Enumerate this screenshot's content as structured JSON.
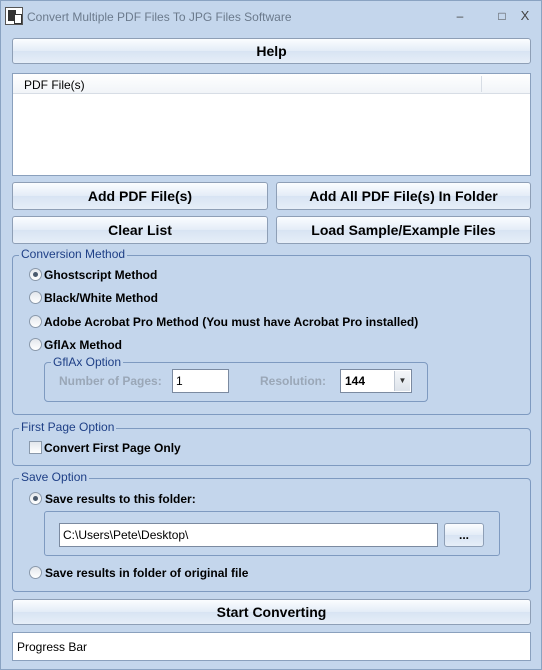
{
  "window": {
    "title": "Convert Multiple PDF Files To JPG Files Software",
    "minimize_glyph": "–",
    "maximize_glyph": "□",
    "close_glyph": "X"
  },
  "buttons": {
    "help": "Help",
    "add_pdf": "Add PDF File(s)",
    "add_all_pdf": "Add All PDF File(s) In Folder",
    "clear_list": "Clear List",
    "load_sample": "Load Sample/Example Files",
    "start_converting": "Start Converting",
    "browse": "..."
  },
  "file_list": {
    "columns": [
      "PDF File(s)"
    ],
    "rows": []
  },
  "conversion_method": {
    "label": "Conversion Method",
    "options": [
      {
        "label": "Ghostscript Method",
        "selected": true
      },
      {
        "label": "Black/White Method",
        "selected": false
      },
      {
        "label": "Adobe Acrobat Pro Method (You must have Acrobat Pro installed)",
        "selected": false
      },
      {
        "label": "GflAx Method",
        "selected": false
      }
    ],
    "gflax": {
      "label": "GflAx Option",
      "pages_label": "Number of Pages:",
      "pages_value": "1",
      "resolution_label": "Resolution:",
      "resolution_value": "144"
    }
  },
  "first_page": {
    "label": "First Page Option",
    "checkbox_label": "Convert First Page Only",
    "checked": false
  },
  "save_option": {
    "label": "Save Option",
    "folder_option": "Save results to this folder:",
    "folder_selected": true,
    "folder_path": "C:\\Users\\Pete\\Desktop\\",
    "original_option": "Save results in folder of original file",
    "original_selected": false
  },
  "progress": {
    "text": "Progress Bar"
  },
  "colors": {
    "window_bg": "#c4d6ec",
    "group_label": "#1e3f86",
    "disabled_text": "#9aa7b7"
  }
}
